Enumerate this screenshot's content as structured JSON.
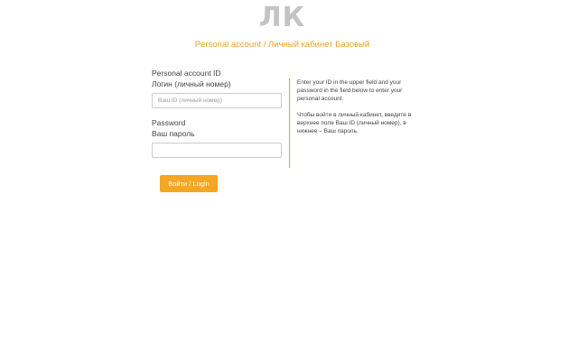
{
  "header": {
    "logo_text": "ЛК",
    "subtitle": "Personal account / Личный кабинет Базовый"
  },
  "form": {
    "login": {
      "title": "Personal account ID",
      "label": "Логин (личный номер)",
      "placeholder": "Ваш ID (личный номер)",
      "value": ""
    },
    "password": {
      "title": "Password",
      "label": "Ваш пароль",
      "placeholder": "",
      "value": ""
    },
    "submit_label": "Войти / Login"
  },
  "help": {
    "english": "Enter your ID in the upper field and your password in the field below to enter your personal account.",
    "russian": "Чтобы войти в личный кабинет, введите в верхнее поле Ваш ID (личный номер), в нижнее – Ваш пароль."
  },
  "colors": {
    "accent": "#f5a623",
    "logo": "#c4c4c4"
  }
}
